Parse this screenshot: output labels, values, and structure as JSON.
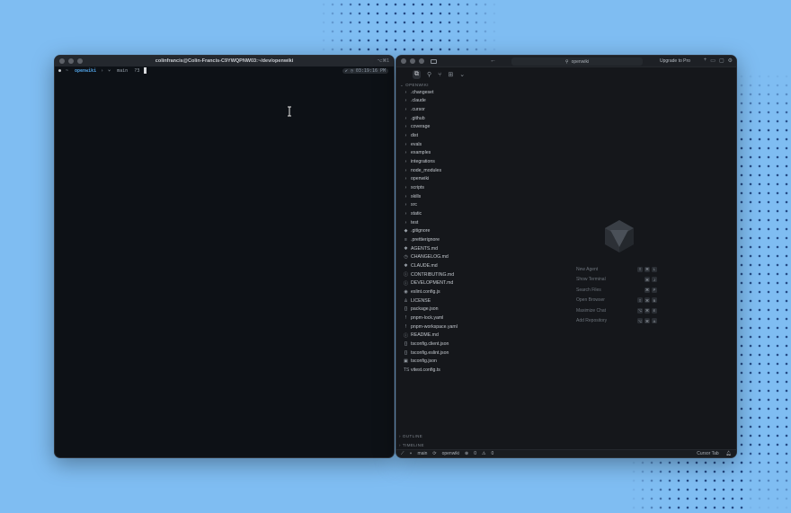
{
  "terminal": {
    "title": "colinfrancis@Colin-Francis-C9YWQPNW03:~/dev/openwiki",
    "shortcut": "⌥⌘1",
    "prompt": {
      "home_icon": "~",
      "dir": "openwiki",
      "git_icon": "branch-icon",
      "branch": "main",
      "status": "?3",
      "time": "✔ ◷ 03:19:16 PM"
    }
  },
  "editor": {
    "search_text": "openwiki",
    "upgrade_label": "Upgrade to Pro",
    "explorer_title": "OPENWIKI",
    "files": [
      {
        "name": ".changeset",
        "type": "folder",
        "icon": "›"
      },
      {
        "name": ".claude",
        "type": "folder",
        "icon": "›"
      },
      {
        "name": ".cursor",
        "type": "folder",
        "icon": "›"
      },
      {
        "name": ".github",
        "type": "folder",
        "icon": "›"
      },
      {
        "name": "coverage",
        "type": "folder",
        "icon": "›"
      },
      {
        "name": "dist",
        "type": "folder",
        "icon": "›"
      },
      {
        "name": "evals",
        "type": "folder",
        "icon": "›"
      },
      {
        "name": "examples",
        "type": "folder",
        "icon": "›"
      },
      {
        "name": "integrations",
        "type": "folder",
        "icon": "›"
      },
      {
        "name": "node_modules",
        "type": "folder",
        "icon": "›"
      },
      {
        "name": "openwiki",
        "type": "folder",
        "icon": "›"
      },
      {
        "name": "scripts",
        "type": "folder",
        "icon": "›"
      },
      {
        "name": "skills",
        "type": "folder",
        "icon": "›"
      },
      {
        "name": "src",
        "type": "folder",
        "icon": "›"
      },
      {
        "name": "static",
        "type": "folder",
        "icon": "›"
      },
      {
        "name": "test",
        "type": "folder",
        "icon": "›"
      },
      {
        "name": ".gitignore",
        "type": "file",
        "icon": "◆"
      },
      {
        "name": ".prettierignore",
        "type": "file",
        "icon": "≡"
      },
      {
        "name": "AGENTS.md",
        "type": "file",
        "icon": "✱"
      },
      {
        "name": "CHANGELOG.md",
        "type": "file",
        "icon": "◷"
      },
      {
        "name": "CLAUDE.md",
        "type": "file",
        "icon": "✱"
      },
      {
        "name": "CONTRIBUTING.md",
        "type": "file",
        "icon": "ⓘ"
      },
      {
        "name": "DEVELOPMENT.md",
        "type": "file",
        "icon": "ⓘ"
      },
      {
        "name": "eslint.config.js",
        "type": "file",
        "icon": "◉"
      },
      {
        "name": "LICENSE",
        "type": "file",
        "icon": "♙"
      },
      {
        "name": "package.json",
        "type": "file",
        "icon": "{}"
      },
      {
        "name": "pnpm-lock.yaml",
        "type": "file",
        "icon": "!"
      },
      {
        "name": "pnpm-workspace.yaml",
        "type": "file",
        "icon": "!"
      },
      {
        "name": "README.md",
        "type": "file",
        "icon": "ⓘ"
      },
      {
        "name": "tsconfig.client.json",
        "type": "file",
        "icon": "{}"
      },
      {
        "name": "tsconfig.eslint.json",
        "type": "file",
        "icon": "{}"
      },
      {
        "name": "tsconfig.json",
        "type": "file",
        "icon": "▣"
      },
      {
        "name": "vitest.config.ts",
        "type": "file",
        "icon": "TS"
      }
    ],
    "outline_label": "OUTLINE",
    "timeline_label": "TIMELINE",
    "shortcuts": [
      {
        "label": "New Agent",
        "keys": [
          "⇧",
          "⌘",
          "L"
        ]
      },
      {
        "label": "Show Terminal",
        "keys": [
          "⌘",
          "J"
        ]
      },
      {
        "label": "Search Files",
        "keys": [
          "⌘",
          "P"
        ]
      },
      {
        "label": "Open Browser",
        "keys": [
          "⇧",
          "⌘",
          "B"
        ]
      },
      {
        "label": "Maximize Chat",
        "keys": [
          "⌥",
          "⌘",
          "E"
        ]
      },
      {
        "label": "Add Repository",
        "keys": [
          "⌥",
          "⌘",
          "A"
        ]
      }
    ],
    "status": {
      "branch": "main",
      "project": "openwiki",
      "errors": "0",
      "warnings": "0",
      "cursor_tab": "Cursor Tab"
    }
  },
  "colors": {
    "desktop": "#7fbdf2",
    "terminal_bg": "#0d1116",
    "editor_bg": "#15171b",
    "accent": "#4f9fe0"
  }
}
